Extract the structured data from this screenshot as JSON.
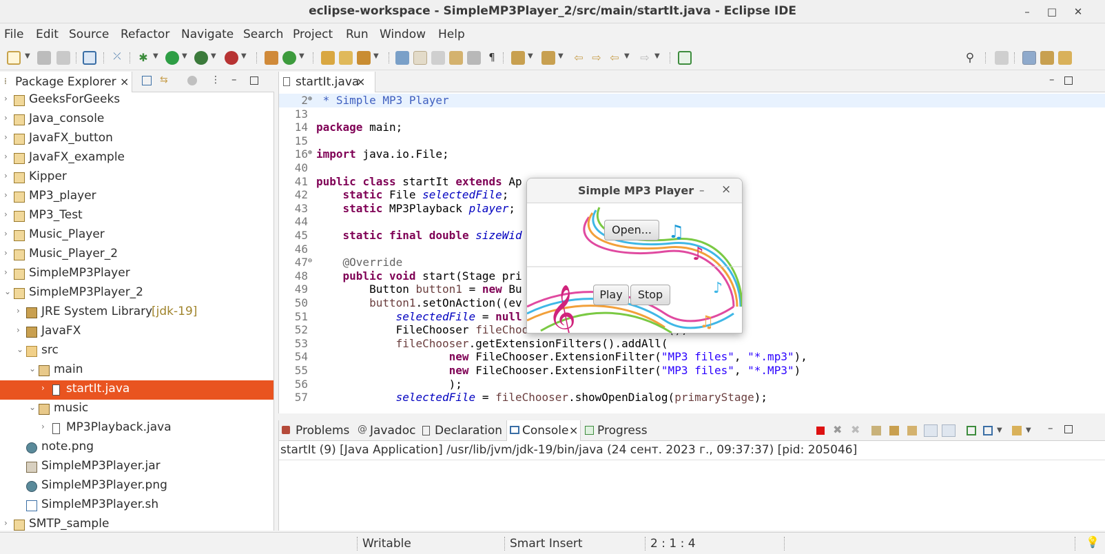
{
  "window": {
    "title": "eclipse-workspace - SimpleMP3Player_2/src/main/startIt.java - Eclipse IDE"
  },
  "menubar": [
    "File",
    "Edit",
    "Source",
    "Refactor",
    "Navigate",
    "Search",
    "Project",
    "Run",
    "Window",
    "Help"
  ],
  "package_explorer": {
    "title": "Package Explorer",
    "items": [
      {
        "label": "GeeksForGeeks",
        "decor": ""
      },
      {
        "label": "Java_console",
        "decor": ""
      },
      {
        "label": "JavaFX_button",
        "decor": ""
      },
      {
        "label": "JavaFX_example",
        "decor": ""
      },
      {
        "label": "Kipper",
        "decor": ""
      },
      {
        "label": "MP3_player",
        "decor": ""
      },
      {
        "label": "MP3_Test",
        "decor": ""
      },
      {
        "label": "Music_Player",
        "decor": ""
      },
      {
        "label": "Music_Player_2",
        "decor": ""
      },
      {
        "label": "SimpleMP3Player",
        "decor": ""
      },
      {
        "label": "SimpleMP3Player_2",
        "decor": ""
      },
      {
        "label": "JRE System Library",
        "decor": "[jdk-19]"
      },
      {
        "label": "JavaFX",
        "decor": ""
      },
      {
        "label": "src",
        "decor": ""
      },
      {
        "label": "main",
        "decor": ""
      },
      {
        "label": "startIt.java",
        "decor": ""
      },
      {
        "label": "music",
        "decor": ""
      },
      {
        "label": "MP3Playback.java",
        "decor": ""
      },
      {
        "label": "note.png",
        "decor": ""
      },
      {
        "label": "SimpleMP3Player.jar",
        "decor": ""
      },
      {
        "label": "SimpleMP3Player.png",
        "decor": ""
      },
      {
        "label": "SimpleMP3Player.sh",
        "decor": ""
      },
      {
        "label": "SMTP_sample",
        "decor": ""
      }
    ]
  },
  "editor": {
    "tab": "startIt.java",
    "lines": [
      {
        "n": "2",
        "text": " * Simple MP3 Player"
      },
      {
        "n": "13",
        "text": ""
      },
      {
        "n": "14",
        "text": "package main;"
      },
      {
        "n": "15",
        "text": ""
      },
      {
        "n": "16",
        "text": "import java.io.File;"
      },
      {
        "n": "40",
        "text": ""
      },
      {
        "n": "41",
        "text": "public class startIt extends Ap"
      },
      {
        "n": "42",
        "text": "    static File selectedFile;"
      },
      {
        "n": "43",
        "text": "    static MP3Playback player;"
      },
      {
        "n": "44",
        "text": ""
      },
      {
        "n": "45",
        "text": "    static final double sizeWid"
      },
      {
        "n": "46",
        "text": ""
      },
      {
        "n": "47",
        "text": "    @Override"
      },
      {
        "n": "48",
        "text": "    public void start(Stage pri"
      },
      {
        "n": "49",
        "text": "        Button button1 = new Bu"
      },
      {
        "n": "50",
        "text": "        button1.setOnAction((ev"
      },
      {
        "n": "51",
        "text": "            selectedFile = null"
      },
      {
        "n": "52",
        "text": "            FileChooser fileChooser = new FileChooser();"
      },
      {
        "n": "53",
        "text": "            fileChooser.getExtensionFilters().addAll("
      },
      {
        "n": "54",
        "text": "                    new FileChooser.ExtensionFilter(\"MP3 files\", \"*.mp3\"),"
      },
      {
        "n": "55",
        "text": "                    new FileChooser.ExtensionFilter(\"MP3 files\", \"*.MP3\")"
      },
      {
        "n": "56",
        "text": "                    );"
      },
      {
        "n": "57",
        "text": "            selectedFile = fileChooser.showOpenDialog(primaryStage);"
      }
    ]
  },
  "dialog": {
    "title": "Simple MP3 Player",
    "open_label": "Open...",
    "play_label": "Play",
    "stop_label": "Stop",
    "minimize": "–",
    "close": "×"
  },
  "bottom_panel": {
    "tabs": [
      "Problems",
      "Javadoc",
      "Declaration",
      "Console",
      "Progress"
    ],
    "active_tab": "Console",
    "console_description": "startIt (9) [Java Application] /usr/lib/jvm/jdk-19/bin/java  (24 сент. 2023 г., 09:37:37) [pid: 205046]"
  },
  "statusbar": {
    "writable": "Writable",
    "insert_mode": "Smart Insert",
    "position": "2 : 1 : 4"
  },
  "colors": {
    "selection": "#e95420",
    "keyword": "#7f0055",
    "field": "#0000c0",
    "string": "#2a00ff"
  }
}
